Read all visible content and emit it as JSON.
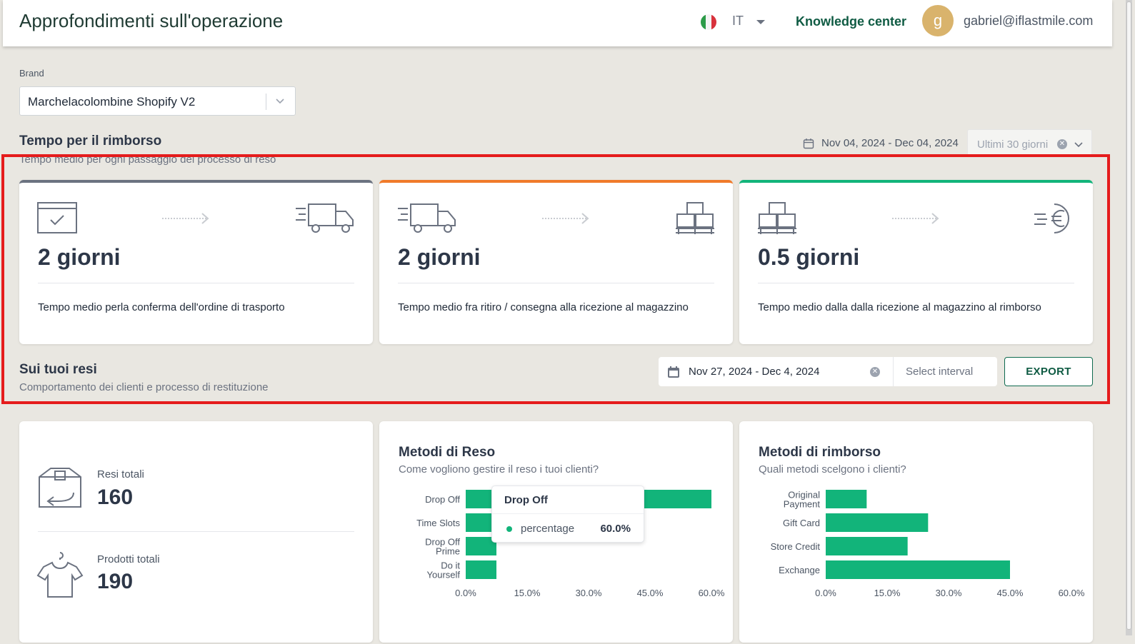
{
  "header": {
    "title": "Approfondimenti sull'operazione",
    "flag_icon": "italy-flag-icon",
    "language": "IT",
    "knowledge_center": "Knowledge center",
    "avatar_letter": "g",
    "user_email": "gabriel@iflastmile.com",
    "colors": {
      "accent": "#0f5b43",
      "avatar": "#d9b36c"
    }
  },
  "brand": {
    "label": "Brand",
    "selected": "Marchelacolombine Shopify V2"
  },
  "refund_time": {
    "title": "Tempo per il rimborso",
    "subtitle": "Tempo medio per ogni passaggio del processo di reso",
    "date_range": "Nov 04, 2024 - Dec 04, 2024",
    "preset": "Ultimi 30 giorni",
    "steps": [
      {
        "value": "2 giorni",
        "desc": "Tempo medio perla conferma dell'ordine di trasporto",
        "color": "#6b7280",
        "icon_left": "browser-check-icon",
        "icon_right": "delivery-truck-icon"
      },
      {
        "value": "2 giorni",
        "desc": "Tempo medio fra ritiro / consegna alla ricezione al magazzino",
        "color": "#f07a2a",
        "icon_left": "delivery-truck-icon",
        "icon_right": "pallet-boxes-icon"
      },
      {
        "value": "0.5 giorni",
        "desc": "Tempo medio dalla dalla ricezione al magazzino al rimborso",
        "color": "#12b47a",
        "icon_left": "pallet-boxes-icon",
        "icon_right": "euro-refund-icon"
      }
    ]
  },
  "returns": {
    "title": "Sui tuoi resi",
    "subtitle": "Comportamento dei clienti e processo di restituzione",
    "date_range": "Nov 27, 2024 - Dec 4, 2024",
    "interval_placeholder": "Select interval",
    "export_label": "EXPORT",
    "total_returns_label": "Resi totali",
    "total_returns": "160",
    "total_products_label": "Prodotti totali",
    "total_products": "190"
  },
  "chart_data": [
    {
      "type": "bar",
      "orientation": "horizontal",
      "title": "Metodi di Reso",
      "subtitle": "Come vogliono gestire il reso i tuoi clienti?",
      "categories": [
        "Drop Off",
        "Time Slots",
        "Drop Off Prime",
        "Do it Yourself"
      ],
      "values": [
        60.0,
        7.5,
        7.5,
        7.5
      ],
      "xlim": [
        0,
        60
      ],
      "ticks": [
        "0.0%",
        "15.0%",
        "30.0%",
        "45.0%",
        "60.0%"
      ],
      "color": "#12b47a",
      "tooltip": {
        "title": "Drop Off",
        "label": "percentage",
        "value": "60.0%"
      }
    },
    {
      "type": "bar",
      "orientation": "horizontal",
      "title": "Metodi di rimborso",
      "subtitle": "Quali metodi scelgono i clienti?",
      "categories": [
        "Original Payment",
        "Gift Card",
        "Store Credit",
        "Exchange"
      ],
      "values": [
        10.0,
        25.0,
        20.0,
        45.0
      ],
      "xlim": [
        0,
        60
      ],
      "ticks": [
        "0.0%",
        "15.0%",
        "30.0%",
        "45.0%",
        "60.0%"
      ],
      "color": "#12b47a"
    }
  ]
}
